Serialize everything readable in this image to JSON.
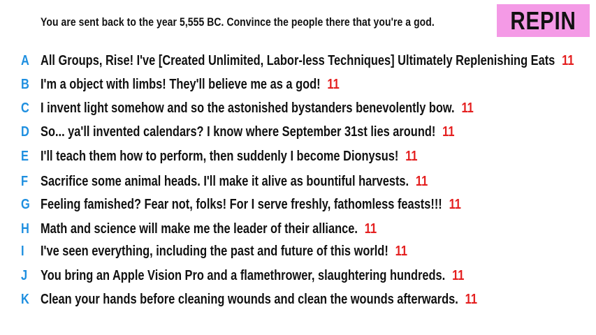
{
  "prompt": "You are sent back to the year 5,555 BC. Convince the people there that you're a god.",
  "badge": {
    "label": "REPIN",
    "color": "#f49ae6"
  },
  "colors": {
    "letter": "#1e8fe0",
    "score": "#e41f1f"
  },
  "answers": [
    {
      "letter": "A",
      "text": "All Groups, Rise! I've [Created Unlimited, Labor-less Techniques] Ultimately Replenishing Eats",
      "score": "11"
    },
    {
      "letter": "B",
      "text": "I'm a object with limbs! They'll believe me as a god!",
      "score": "11"
    },
    {
      "letter": "C",
      "text": "I invent light somehow and so the astonished bystanders benevolently bow.",
      "score": "11"
    },
    {
      "letter": "D",
      "text": "So... ya'll invented calendars? I know where September 31st lies around!",
      "score": "11"
    },
    {
      "letter": "E",
      "text": "I'll teach them how to perform, then suddenly I become Dionysus!",
      "score": "11"
    },
    {
      "letter": "F",
      "text": "Sacrifice some animal heads. I'll make it alive as bountiful harvests.",
      "score": "11"
    },
    {
      "letter": "G",
      "text": "Feeling famished? Fear not, folks! For I serve freshly, fathomless feasts!!!",
      "score": "11"
    },
    {
      "letter": "H",
      "text": "Math and science will make me the leader of their alliance.",
      "score": "11"
    },
    {
      "letter": "I",
      "text": "I've seen everything, including the past and future of this world!",
      "score": "11"
    },
    {
      "letter": "J",
      "text": "You bring an Apple Vision Pro and a flamethrower, slaughtering hundreds.",
      "score": "11"
    },
    {
      "letter": "K",
      "text": "Clean your hands before cleaning wounds and clean the wounds afterwards.",
      "score": "11"
    }
  ]
}
